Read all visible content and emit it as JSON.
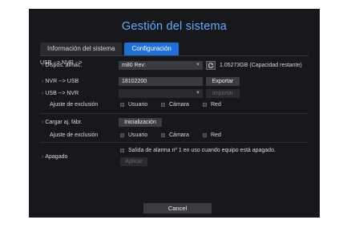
{
  "title": "Gestión del sistema",
  "tabs": [
    {
      "label": "Información del sistema",
      "active": false
    },
    {
      "label": "Configuración",
      "active": true
    }
  ],
  "storage": {
    "label": "Dispos. almac.",
    "device_value": "m80 Rev:",
    "capacity": "1.05273GB (Capacidad restante)",
    "icon": "refresh-icon"
  },
  "nvr_to_usb": {
    "label": "NVR --> USB",
    "value": "18102200",
    "button": "Exportar"
  },
  "usb_to_nvr": {
    "label": "USB --> NVR",
    "value": "",
    "button": "Importar"
  },
  "exclusion_1": {
    "label": "Ajuste de exclusión",
    "options": [
      "Usuario",
      "Cámara",
      "Red"
    ]
  },
  "factory": {
    "label": "Cargar aj. fábr.",
    "button": "Inicialización"
  },
  "exclusion_2": {
    "label": "Ajuste de exclusión",
    "options": [
      "Usuario",
      "Cámara",
      "Red"
    ]
  },
  "shutdown": {
    "label": "Apagado",
    "checkbox_text": "Salida de alarma nº 1 en uso cuando equipo está apagado.",
    "button": "Aplicar"
  },
  "footer": {
    "cancel": "Cancel"
  },
  "colors": {
    "accent": "#1f6fd8",
    "title": "#67a9ff",
    "panel": "#17181b"
  }
}
